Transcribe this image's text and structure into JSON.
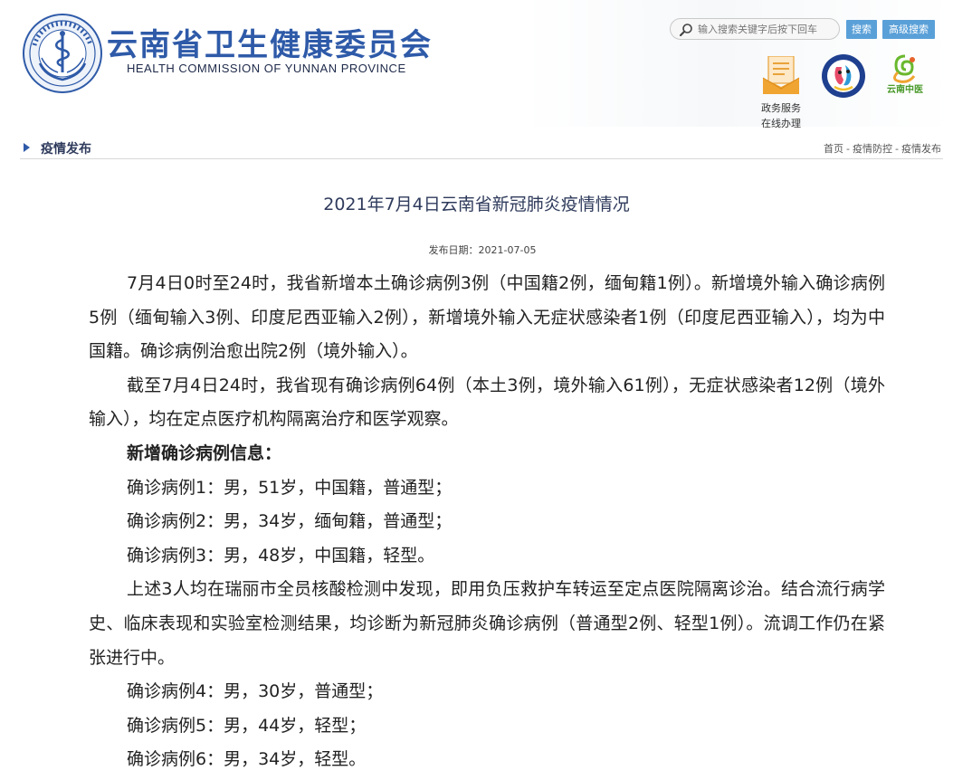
{
  "header": {
    "site_name_cn": "云南省卫生健康委员会",
    "site_name_en": "HEALTH COMMISSION OF YUNNAN PROVINCE",
    "search": {
      "placeholder": "输入搜索关键字后按下回车",
      "search_label": "搜索",
      "advanced_label": "高级搜索"
    },
    "quick_links": {
      "gov_service_line1": "政务服务",
      "gov_service_line2": "在线办理",
      "tcm_logo_text": "云南中医"
    },
    "brand_color": "#2e5aa8",
    "button_color": "#5aa0d8"
  },
  "section": {
    "title": "疫情发布",
    "breadcrumb": [
      "首页",
      "疫情防控",
      "疫情发布"
    ],
    "separator": "-"
  },
  "article": {
    "title": "2021年7月4日云南省新冠肺炎疫情情况",
    "date_label": "发布日期：",
    "date": "2021-07-05",
    "paragraphs": [
      "7月4日0时至24时，我省新增本土确诊病例3例（中国籍2例，缅甸籍1例）。新增境外输入确诊病例5例（缅甸输入3例、印度尼西亚输入2例），新增境外输入无症状感染者1例（印度尼西亚输入），均为中国籍。确诊病例治愈出院2例（境外输入）。",
      "截至7月4日24时，我省现有确诊病例64例（本土3例，境外输入61例），无症状感染者12例（境外输入），均在定点医疗机构隔离治疗和医学观察。",
      "新增确诊病例信息：",
      "确诊病例1：男，51岁，中国籍，普通型；",
      "确诊病例2：男，34岁，缅甸籍，普通型；",
      "确诊病例3：男，48岁，中国籍，轻型。",
      "上述3人均在瑞丽市全员核酸检测中发现，即用负压救护车转运至定点医院隔离诊治。结合流行病学史、临床表现和实验室检测结果，均诊断为新冠肺炎确诊病例（普通型2例、轻型1例）。流调工作仍在紧张进行中。",
      "确诊病例4：男，30岁，普通型；",
      "确诊病例5：男，44岁，轻型；",
      "确诊病例6：男，34岁，轻型。"
    ]
  }
}
